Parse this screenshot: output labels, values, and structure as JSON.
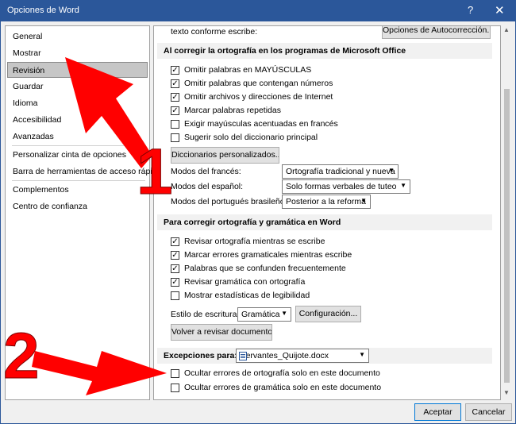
{
  "title": "Opciones de Word",
  "titlebar": {
    "help": "?",
    "close": "✕"
  },
  "nav": [
    "General",
    "Mostrar",
    "Revisión",
    "Guardar",
    "Idioma",
    "Accesibilidad",
    "Avanzadas",
    "Personalizar cinta de opciones",
    "Barra de herramientas de acceso rápido",
    "Complementos",
    "Centro de confianza"
  ],
  "selected_nav": "Revisión",
  "top": {
    "partial_label": "texto conforme escribe:",
    "autocorrect_btn": "Opciones de Autocorrección..."
  },
  "spelling_office": {
    "heading": "Al corregir la ortografía en los programas de Microsoft Office",
    "options": [
      {
        "label": "Omitir palabras en MAYÚSCULAS",
        "checked": true
      },
      {
        "label": "Omitir palabras que contengan números",
        "checked": true
      },
      {
        "label": "Omitir archivos y direcciones de Internet",
        "checked": true
      },
      {
        "label": "Marcar palabras repetidas",
        "checked": true
      },
      {
        "label": "Exigir mayúsculas acentuadas en francés",
        "checked": false
      },
      {
        "label": "Sugerir solo del diccionario principal",
        "checked": false
      }
    ],
    "custom_dict_btn": "Diccionarios personalizados...",
    "modes": [
      {
        "label": "Modos del francés:",
        "value": "Ortografía tradicional y nueva"
      },
      {
        "label": "Modos del español:",
        "value": "Solo formas verbales de tuteo"
      },
      {
        "label": "Modos del portugués brasileño:",
        "value": "Posterior a la reforma"
      }
    ]
  },
  "grammar_word": {
    "heading": "Para corregir ortografía y gramática en Word",
    "options": [
      {
        "label": "Revisar ortografía mientras se escribe",
        "checked": true
      },
      {
        "label": "Marcar errores gramaticales mientras escribe",
        "checked": true
      },
      {
        "label": "Palabras que se confunden frecuentemente",
        "checked": true
      },
      {
        "label": "Revisar gramática con ortografía",
        "checked": true
      },
      {
        "label": "Mostrar estadísticas de legibilidad",
        "checked": false
      }
    ],
    "style_label": "Estilo de escritura:",
    "style_value": "Gramática",
    "config_btn": "Configuración...",
    "recheck_btn": "Volver a revisar documento"
  },
  "exceptions": {
    "heading": "Excepciones para:",
    "document": "Cervantes_Quijote.docx",
    "options": [
      {
        "label": "Ocultar errores de ortografía solo en este documento",
        "checked": false
      },
      {
        "label": "Ocultar errores de gramática solo en este documento",
        "checked": false
      }
    ]
  },
  "footer": {
    "ok": "Aceptar",
    "cancel": "Cancelar"
  },
  "annotations": {
    "one": "1",
    "two": "2",
    "color": "#ff0000"
  },
  "icons": {
    "checkmark": "✓",
    "dropdown": "▼",
    "scroll_up": "▲",
    "scroll_down": "▼"
  }
}
